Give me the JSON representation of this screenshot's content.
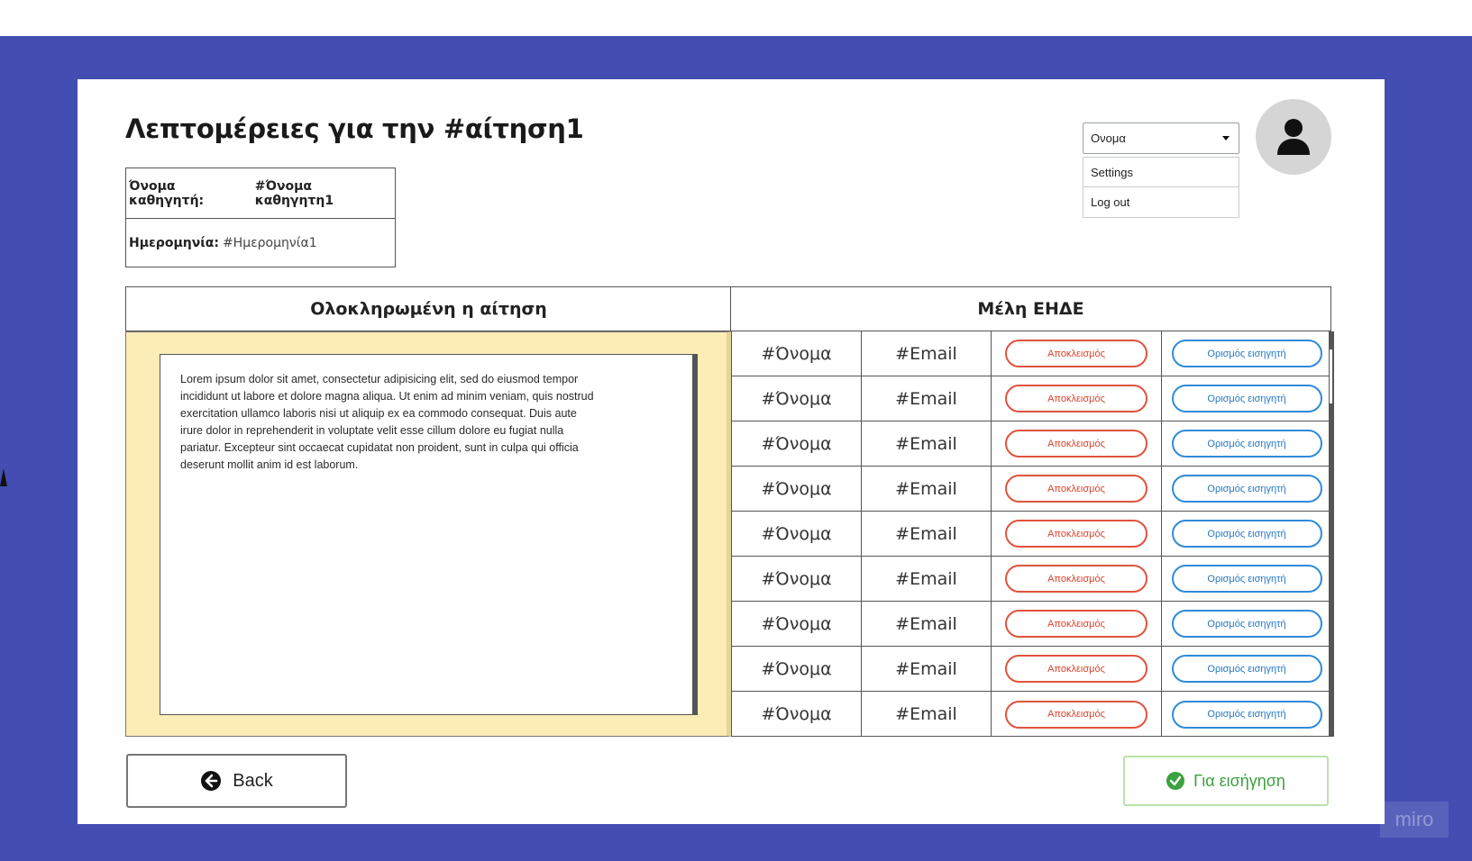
{
  "page": {
    "title": "Λεπτομέρειες για την #αίτηση1"
  },
  "info": {
    "professor_label": "Όνομα καθηγητή:",
    "professor_value": "#Όνομα καθηγητη1",
    "date_label": "Ημερομηνία:",
    "date_value": "#Ημερομηνία1"
  },
  "user_menu": {
    "selected": "Ονομα",
    "items": [
      "Settings",
      "Log out"
    ]
  },
  "panels": {
    "left_title": "Ολοκληρωμένη η αίτηση",
    "right_title": "Μέλη ΕΗΔΕ"
  },
  "request_text": "Lorem ipsum dolor sit amet, consectetur adipisicing elit, sed do eiusmod tempor incididunt ut labore et dolore magna aliqua. Ut enim ad minim veniam, quis nostrud exercitation ullamco laboris nisi ut aliquip ex ea commodo consequat. Duis aute irure dolor in reprehenderit in voluptate velit esse cillum dolore eu fugiat nulla pariatur. Excepteur sint occaecat cupidatat non proident, sunt in culpa qui officia deserunt mollit anim id est laborum.",
  "members": [
    {
      "name": "#Όνομα",
      "email": "#Email",
      "exclude": "Αποκλεισμός",
      "assign": "Ορισμός εισηγητή"
    },
    {
      "name": "#Όνομα",
      "email": "#Email",
      "exclude": "Αποκλεισμός",
      "assign": "Ορισμός εισηγητή"
    },
    {
      "name": "#Όνομα",
      "email": "#Email",
      "exclude": "Αποκλεισμός",
      "assign": "Ορισμός εισηγητή"
    },
    {
      "name": "#Όνομα",
      "email": "#Email",
      "exclude": "Αποκλεισμός",
      "assign": "Ορισμός εισηγητή"
    },
    {
      "name": "#Όνομα",
      "email": "#Email",
      "exclude": "Αποκλεισμός",
      "assign": "Ορισμός εισηγητή"
    },
    {
      "name": "#Όνομα",
      "email": "#Email",
      "exclude": "Αποκλεισμός",
      "assign": "Ορισμός εισηγητή"
    },
    {
      "name": "#Όνομα",
      "email": "#Email",
      "exclude": "Αποκλεισμός",
      "assign": "Ορισμός εισηγητή"
    },
    {
      "name": "#Όνομα",
      "email": "#Email",
      "exclude": "Αποκλεισμός",
      "assign": "Ορισμός εισηγητή"
    },
    {
      "name": "#Όνομα",
      "email": "#Email",
      "exclude": "Αποκλεισμός",
      "assign": "Ορισμός εισηγητή"
    }
  ],
  "actions": {
    "back_label": "Back",
    "submit_label": "Για εισήγηση"
  },
  "watermark": "miro",
  "colors": {
    "backdrop": "#434db2",
    "panel_yellow": "#fcecb6",
    "exclude_red": "#e0533d",
    "assign_blue": "#2f8bd9",
    "submit_green": "#3ba23f"
  },
  "icons": {
    "avatar": "user-icon",
    "back": "arrow-left-circle-icon",
    "submit": "check-circle-icon",
    "dropdown": "caret-down-icon"
  }
}
